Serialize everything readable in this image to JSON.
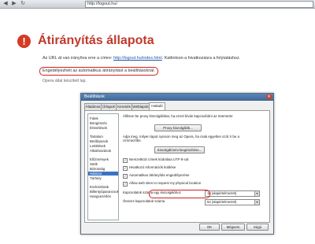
{
  "browser": {
    "url": "http://logout.hu/",
    "back_glyph": "◀",
    "forward_glyph": "▶",
    "reload_glyph": "↻"
  },
  "page": {
    "warning_glyph": "!",
    "title": "Átirányítás állapota",
    "intro_prefix": "Az URL át van irányítva erre a címre: ",
    "intro_link": "http://logout.hu/index.html",
    "intro_suffix": ". Kattintson a hivatkozásra a folytatáshoz.",
    "enable_link": "Engedélyezheti az automatikus átirányítást a beállításoknál.",
    "opera_note": "Opera által készített lap."
  },
  "dialog": {
    "title": "Beállítások",
    "close_glyph": "✕",
    "tabs": [
      "Általános",
      "Űrlapok",
      "Keresés",
      "Weblapok",
      "Haladó"
    ],
    "active_tab": "Haladó",
    "categories": [
      "Fülek",
      "Böngészés",
      "Értesítések",
      "Tartalom",
      "Betűtípusok",
      "Letöltések",
      "Alkalmazások",
      "Előzmények",
      "Sütik",
      "Biztonság",
      "Hálózat",
      "Tárhely",
      "Eszköztárak",
      "Billentyűparancsok",
      "Hangvezérlés"
    ],
    "selected_category": "Hálózat",
    "proxy_text": "Állítson be proxy kiszolgálókat, ha ezzel kíván kapcsolódni az Internetre",
    "proxy_button": "Proxy kiszolgálók...",
    "server_text": "Adja meg, milyen lapot nyisson meg az Opera, ha csak egyetlen szót ír be a címmezőbe.",
    "server_button": "Kiszolgálónév-kiegészítése...",
    "checkboxes": [
      {
        "label": "Nemzetközi címek kódolása UTF-8-cal",
        "checked": true
      },
      {
        "label": "Hivatkozó információk küldése",
        "checked": true
      },
      {
        "label": "Automatikus átirányítás engedélyezése",
        "checked": true
      },
      {
        "label": "Allow web sites to request my physical location",
        "checked": true
      }
    ],
    "max_per_server_label": "Kapcsolatok száma egy kiszolgálóhoz",
    "max_per_server_value": "16 (alapértelmezett)",
    "max_total_label": "Összes kapcsolatok száma",
    "max_total_value": "64 (alapértelmezett)",
    "dropdown_arrow": "▾",
    "ok": "OK",
    "cancel": "Mégsem",
    "help": "Súgó"
  }
}
